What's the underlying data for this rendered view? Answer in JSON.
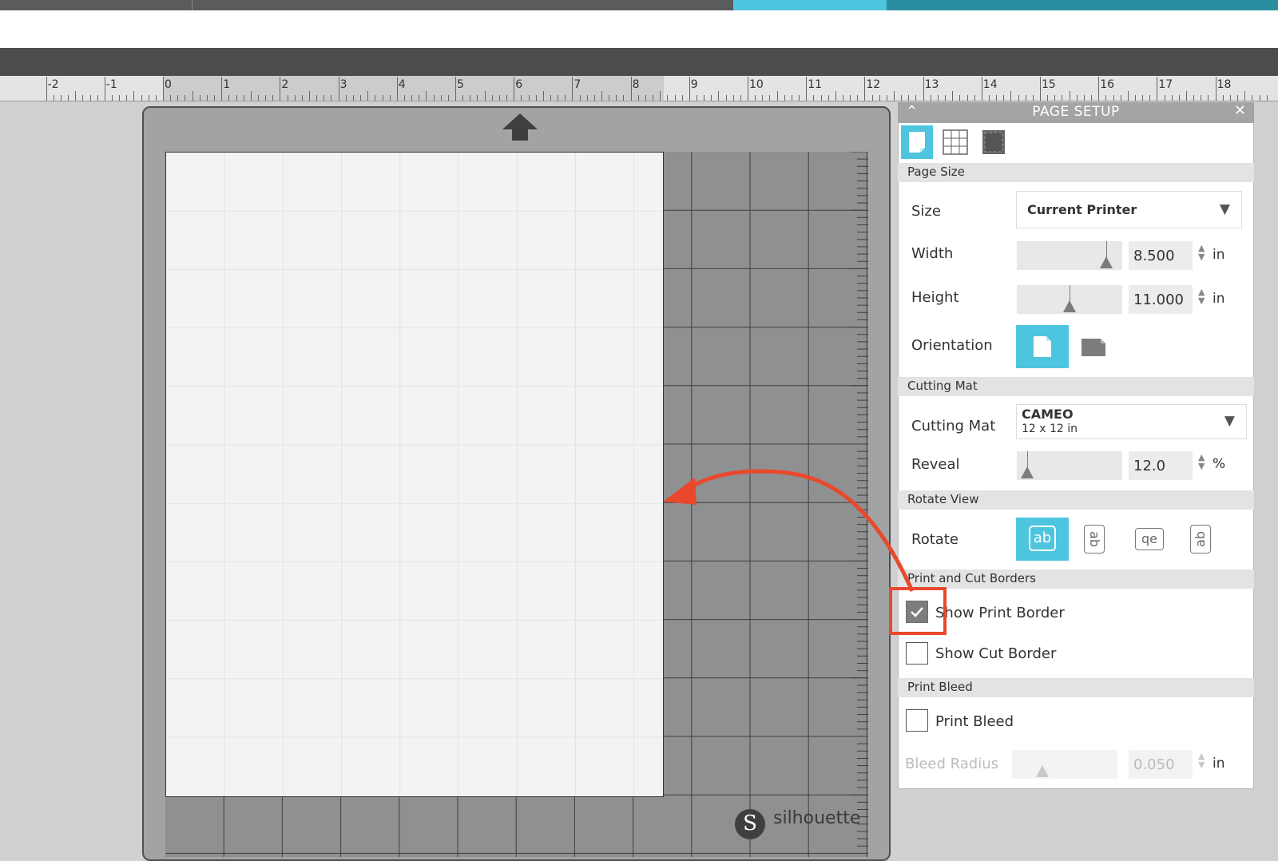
{
  "ruler": {
    "labels": [
      "-2",
      "-1",
      "0",
      "1",
      "2",
      "3",
      "4",
      "5",
      "6",
      "7",
      "8",
      "9",
      "10",
      "11",
      "12",
      "13",
      "14",
      "15",
      "16",
      "17",
      "18"
    ]
  },
  "mat": {
    "brand": "silhouette",
    "logo_letter": "S"
  },
  "panel": {
    "title": "PAGE SETUP",
    "page_size": {
      "section": "Page Size",
      "size_label": "Size",
      "size_value": "Current Printer",
      "width_label": "Width",
      "width_value": "8.500",
      "width_unit": "in",
      "width_fraction": 0.85,
      "height_label": "Height",
      "height_value": "11.000",
      "height_unit": "in",
      "height_fraction": 0.5,
      "orientation_label": "Orientation"
    },
    "cutting_mat": {
      "section": "Cutting Mat",
      "label": "Cutting Mat",
      "value_name": "CAMEO",
      "value_size": "12 x 12 in",
      "reveal_label": "Reveal",
      "reveal_value": "12.0",
      "reveal_unit": "%",
      "reveal_fraction": 0.1
    },
    "rotate_view": {
      "section": "Rotate View",
      "label": "Rotate",
      "options": [
        "ab",
        "ab",
        "qe",
        "ab"
      ]
    },
    "borders": {
      "section": "Print and Cut Borders",
      "show_print_border": "Show Print Border",
      "show_print_border_checked": true,
      "show_cut_border": "Show Cut Border",
      "show_cut_border_checked": false
    },
    "bleed": {
      "section": "Print Bleed",
      "print_bleed": "Print Bleed",
      "print_bleed_checked": false,
      "radius_label": "Bleed Radius",
      "radius_value": "0.050",
      "radius_unit": "in"
    }
  },
  "colors": {
    "accent": "#4ec5de",
    "annotation": "#e8492c"
  }
}
